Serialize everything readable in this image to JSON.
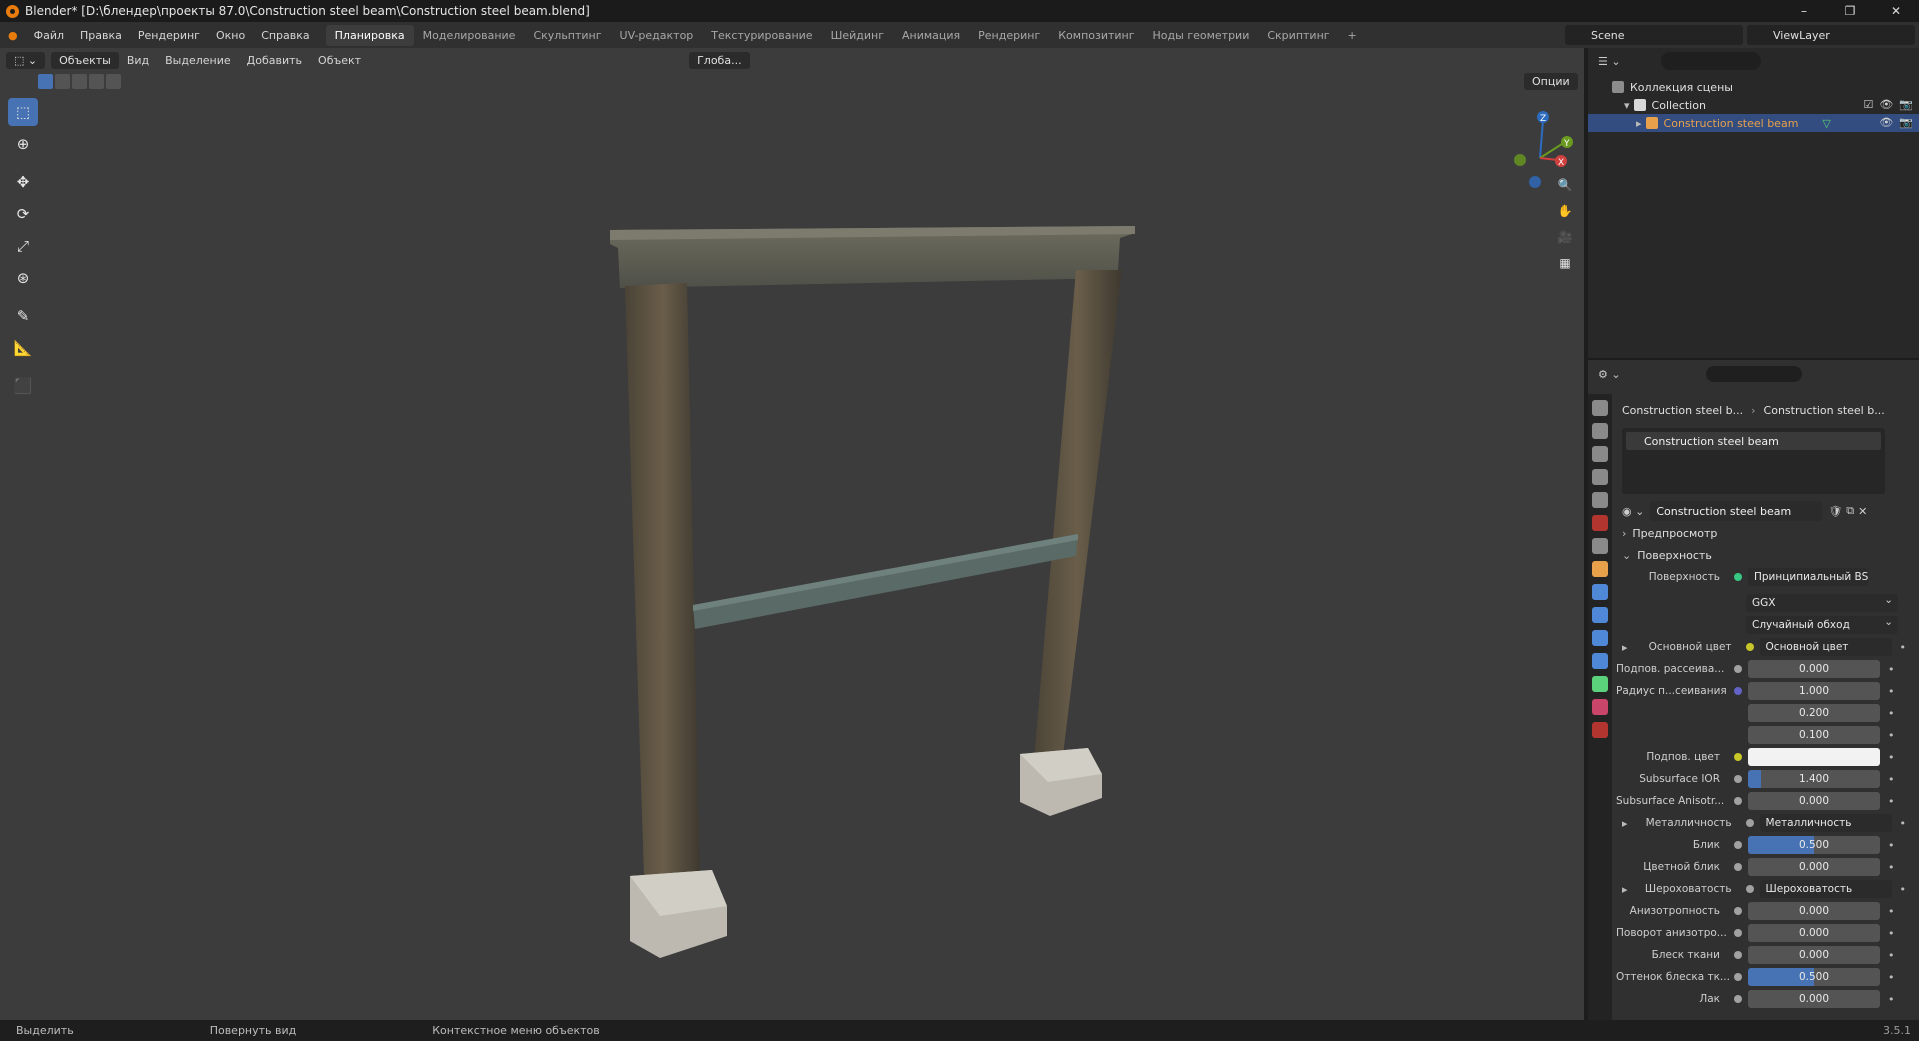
{
  "window": {
    "title": "Blender* [D:\\блендер\\проекты 87.0\\Construction steel beam\\Construction steel beam.blend]",
    "min": "–",
    "max": "❐",
    "close": "✕"
  },
  "menu": {
    "items": [
      "Файл",
      "Правка",
      "Рендеринг",
      "Окно",
      "Справка"
    ]
  },
  "workspaces": {
    "tabs": [
      "Планировка",
      "Моделирование",
      "Скульптинг",
      "UV-редактор",
      "Текстурирование",
      "Шейдинг",
      "Анимация",
      "Рендеринг",
      "Композитинг",
      "Ноды геометрии",
      "Скриптинг"
    ],
    "active": 0,
    "add": "+"
  },
  "scene": {
    "name": "Scene",
    "viewlayer": "ViewLayer"
  },
  "viewport": {
    "mode": "Объекты",
    "menus": [
      "Вид",
      "Выделение",
      "Добавить",
      "Объект"
    ],
    "orientation": "Глоба...",
    "options": "Опции"
  },
  "gizmo": {
    "z": "Z",
    "y": "Y",
    "x": "X"
  },
  "outliner": {
    "root": "Коллекция сцены",
    "collection": "Collection",
    "object": "Construction steel beam"
  },
  "properties": {
    "breadcrumb": [
      "Construction steel b...",
      "Construction steel b..."
    ],
    "slot": "Construction steel beam",
    "material": "Construction steel beam",
    "preview": "Предпросмотр",
    "surface_panel": "Поверхность",
    "surface_label": "Поверхность",
    "surface_shader": "Принципиальный BSDF",
    "distribution": "GGX",
    "subsurface_method": "Случайный обход",
    "rows": [
      {
        "label": "Основной цвет",
        "value": "Основной цвет",
        "kind": "socket",
        "expand": true,
        "dot": "#c7c729"
      },
      {
        "label": "Подпов. рассеива...",
        "value": "0.000",
        "kind": "float",
        "fill": 0,
        "dot": "#a1a1a1"
      },
      {
        "label": "Радиус п...сеивания",
        "value": "1.000",
        "kind": "float",
        "fill": 0,
        "dot": "#6363c7"
      },
      {
        "label": "",
        "value": "0.200",
        "kind": "float",
        "fill": 0,
        "dot": ""
      },
      {
        "label": "",
        "value": "0.100",
        "kind": "float",
        "fill": 0,
        "dot": ""
      },
      {
        "label": "Подпов. цвет",
        "value": "",
        "kind": "color",
        "dot": "#c7c729"
      },
      {
        "label": "Subsurface IOR",
        "value": "1.400",
        "kind": "float",
        "fill": 0.1,
        "dot": "#a1a1a1"
      },
      {
        "label": "Subsurface Anisotr...",
        "value": "0.000",
        "kind": "float",
        "fill": 0,
        "dot": "#a1a1a1"
      },
      {
        "label": "Металличность",
        "value": "Металличность",
        "kind": "socket",
        "expand": true,
        "dot": "#a1a1a1"
      },
      {
        "label": "Блик",
        "value": "0.500",
        "kind": "float",
        "fill": 0.5,
        "dot": "#a1a1a1"
      },
      {
        "label": "Цветной блик",
        "value": "0.000",
        "kind": "float",
        "fill": 0,
        "dot": "#a1a1a1"
      },
      {
        "label": "Шероховатость",
        "value": "Шероховатость",
        "kind": "socket",
        "expand": true,
        "dot": "#a1a1a1"
      },
      {
        "label": "Анизотропность",
        "value": "0.000",
        "kind": "float",
        "fill": 0,
        "dot": "#a1a1a1"
      },
      {
        "label": "Поворот анизотро...",
        "value": "0.000",
        "kind": "float",
        "fill": 0,
        "dot": "#a1a1a1"
      },
      {
        "label": "Блеск ткани",
        "value": "0.000",
        "kind": "float",
        "fill": 0,
        "dot": "#a1a1a1"
      },
      {
        "label": "Оттенок блеска тк...",
        "value": "0.500",
        "kind": "float",
        "fill": 0.5,
        "dot": "#a1a1a1"
      },
      {
        "label": "Лак",
        "value": "0.000",
        "kind": "float",
        "fill": 0,
        "dot": "#a1a1a1"
      }
    ]
  },
  "status": {
    "items": [
      "Выделить",
      "Повернуть вид",
      "Контекстное меню объектов"
    ],
    "version": "3.5.1"
  },
  "colors": {
    "accent": "#4772b3",
    "selection": "#334d80",
    "object_highlight": "#e8a14a"
  }
}
